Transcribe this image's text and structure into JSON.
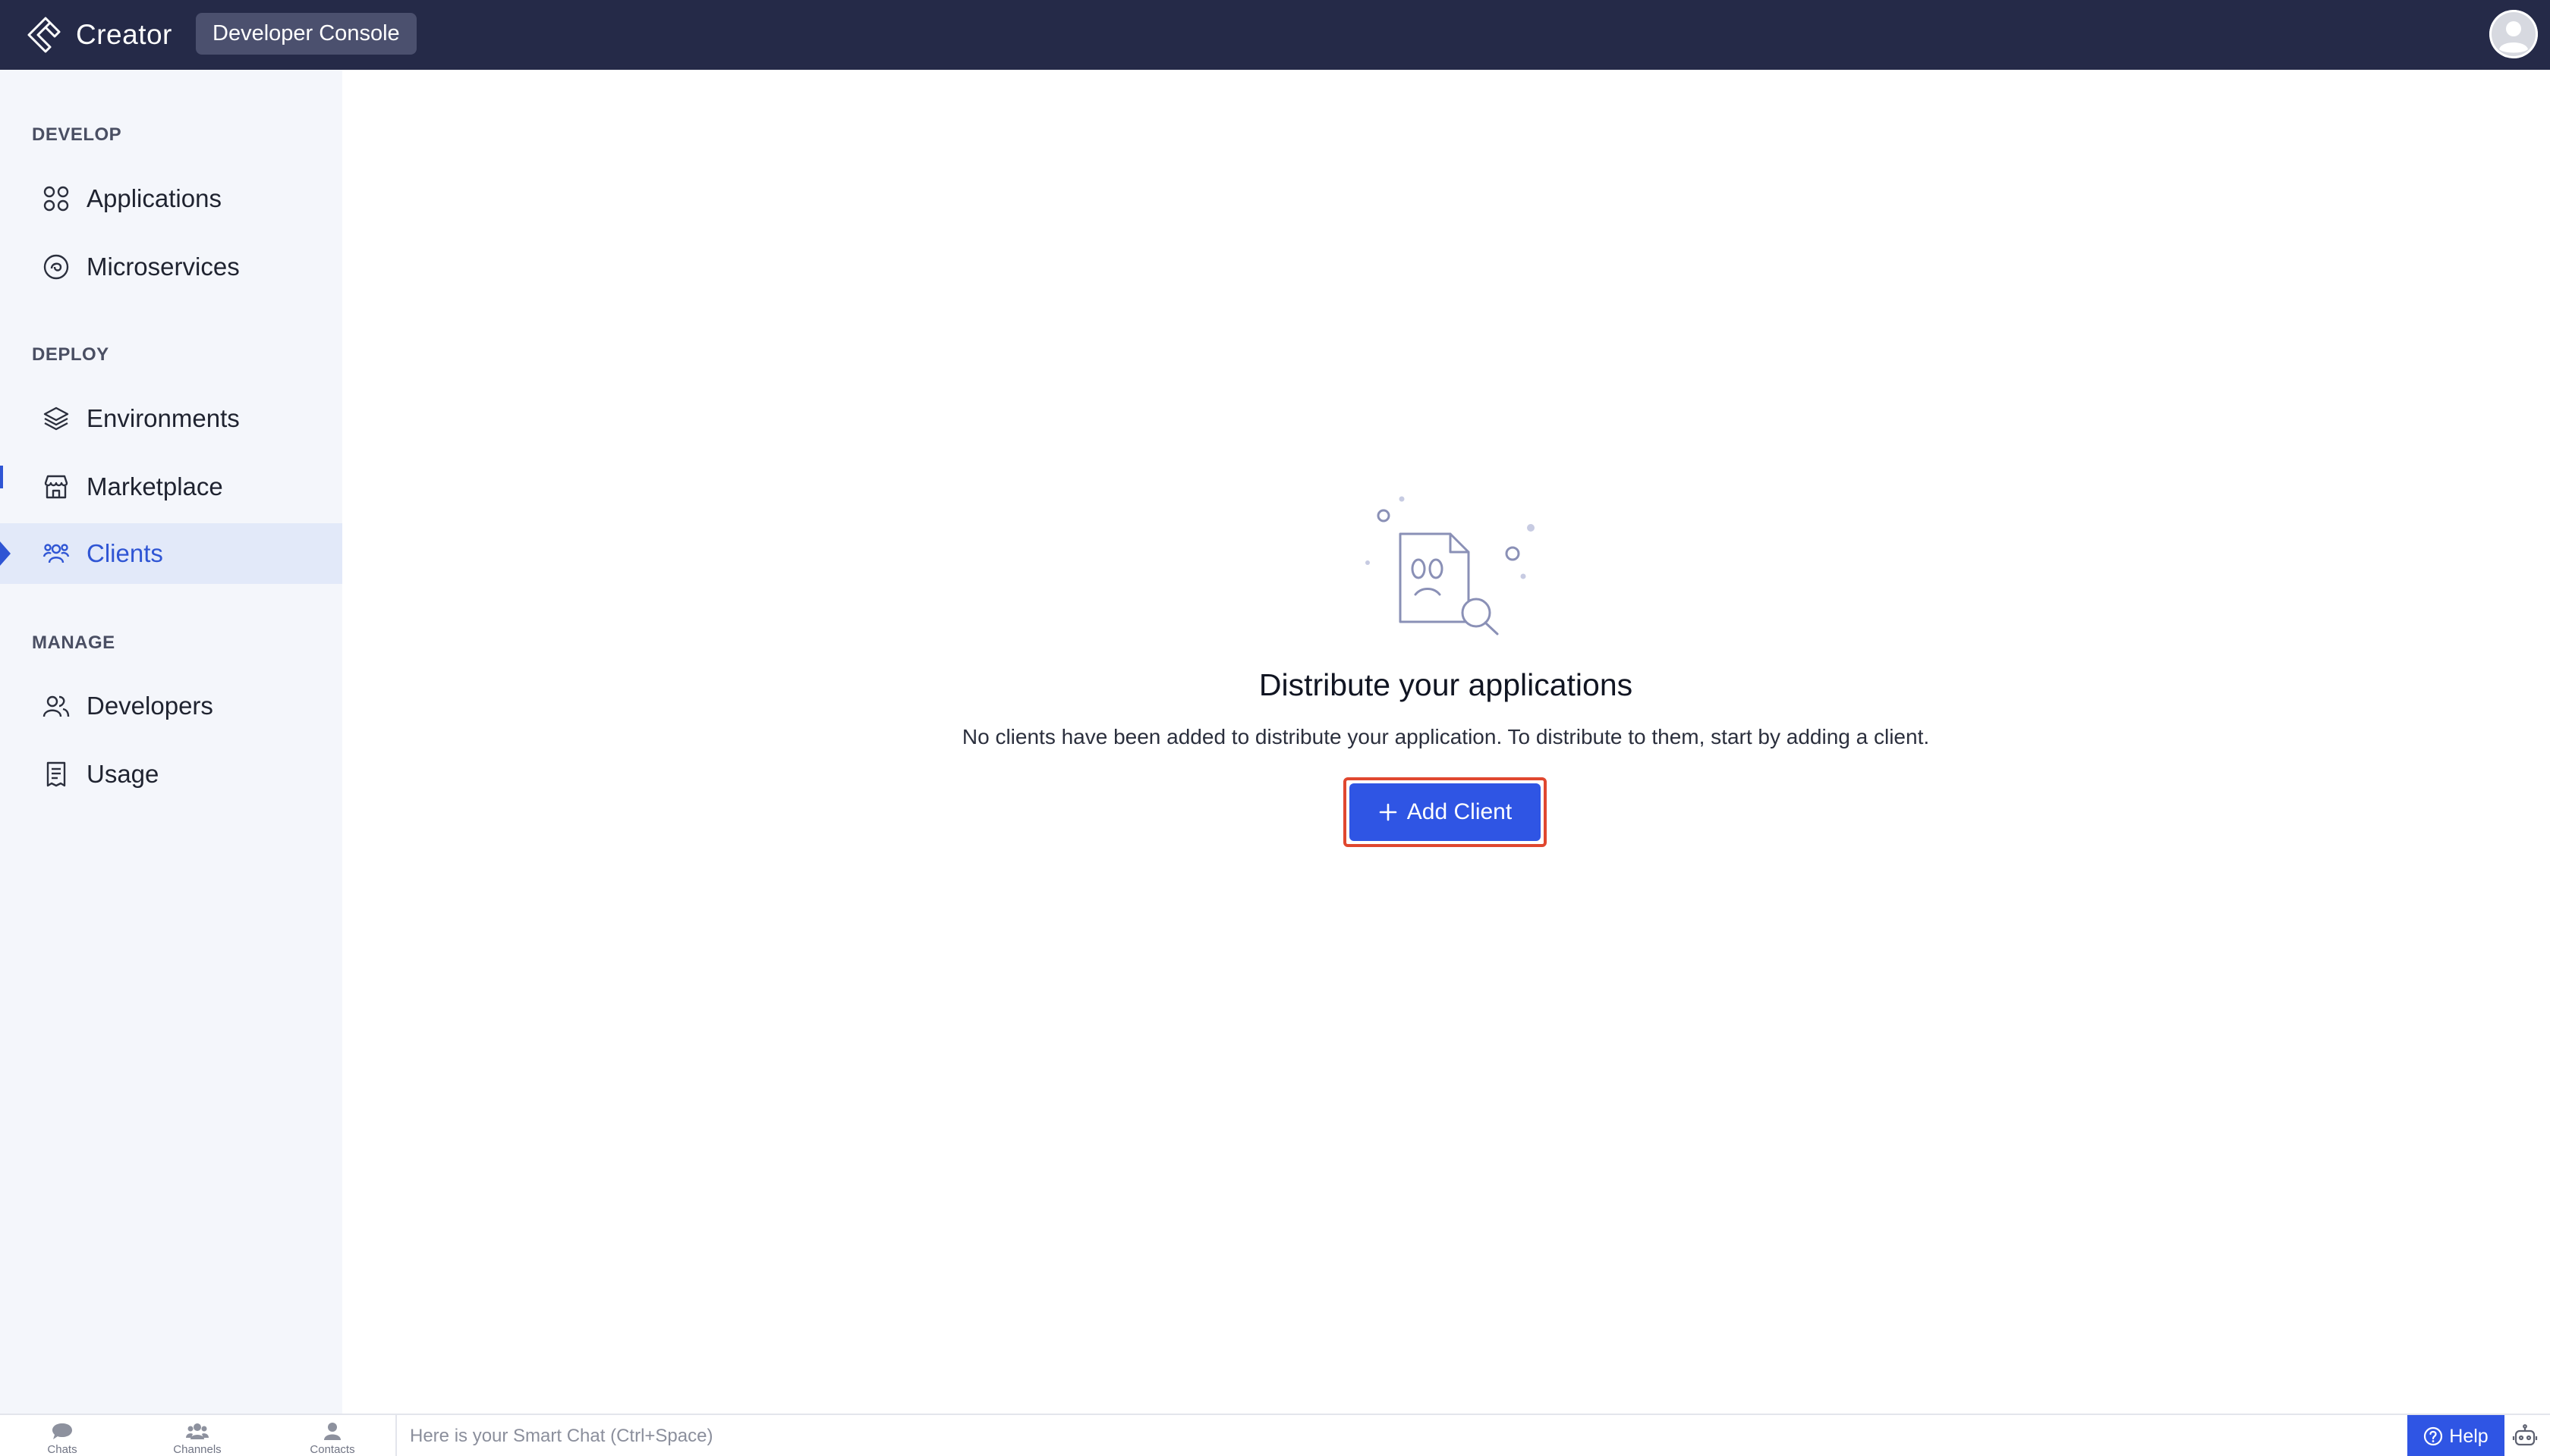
{
  "header": {
    "brand_name": "Creator",
    "console_label": "Developer Console"
  },
  "sidebar": {
    "sections": [
      {
        "label": "DEVELOP"
      },
      {
        "label": "DEPLOY"
      },
      {
        "label": "MANAGE"
      }
    ],
    "items": [
      {
        "label": "Applications",
        "icon": "applications-icon"
      },
      {
        "label": "Microservices",
        "icon": "microservices-icon"
      },
      {
        "label": "Environments",
        "icon": "layers-icon"
      },
      {
        "label": "Marketplace",
        "icon": "store-icon"
      },
      {
        "label": "Clients",
        "icon": "clients-icon",
        "active": true
      },
      {
        "label": "Developers",
        "icon": "developers-icon"
      },
      {
        "label": "Usage",
        "icon": "usage-icon"
      }
    ]
  },
  "main": {
    "empty_title": "Distribute your applications",
    "empty_description": "No clients have been added to distribute your application. To distribute to them, start by adding a client.",
    "add_button_label": "Add Client"
  },
  "bottom_bar": {
    "tabs": [
      {
        "label": "Chats"
      },
      {
        "label": "Channels"
      },
      {
        "label": "Contacts"
      }
    ],
    "smart_chat_placeholder": "Here is your Smart Chat (Ctrl+Space)",
    "help_label": "Help"
  },
  "colors": {
    "topbar": "#252a48",
    "accent": "#2f55e4",
    "active_text": "#2f55d4",
    "highlight_border": "#e0472f",
    "sidebar_bg": "#f4f6fb"
  }
}
